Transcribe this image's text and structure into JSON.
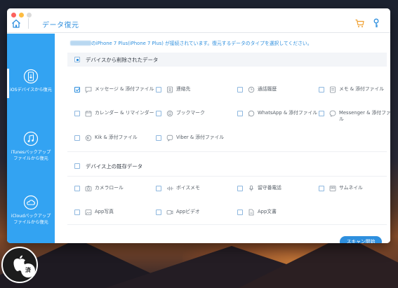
{
  "window": {
    "title": "データ復元"
  },
  "toolbar": {
    "home_icon": "home-icon",
    "cart_icon": "cart-icon",
    "key_icon": "key-icon",
    "accent_color": "#2e8fde",
    "cart_color": "#f0a030"
  },
  "sidebar": {
    "background": "#33a3f2",
    "items": [
      {
        "label": "iOSデバイスから復元",
        "icon": "ios-device-icon",
        "active": true
      },
      {
        "label": "iTunesバックアップファイルから復元",
        "icon": "itunes-music-icon",
        "active": false
      },
      {
        "label": "iCloudバックアップファイルから復元",
        "icon": "icloud-icon",
        "active": false
      }
    ]
  },
  "notice": {
    "text": "のiPhone 7 Plus(iPhone 7 Plus) が接続されています。復元するデータのタイプを選択してください。"
  },
  "sections": [
    {
      "title": "デバイスから削除されたデータ",
      "state": "partial",
      "options": [
        {
          "label": "メッセージ & 添付ファイル",
          "icon": "message-icon",
          "checked": true
        },
        {
          "label": "連絡先",
          "icon": "contacts-icon",
          "checked": false
        },
        {
          "label": "通話履歴",
          "icon": "call-history-icon",
          "checked": false
        },
        {
          "label": "メモ & 添付ファイル",
          "icon": "notes-icon",
          "checked": false
        },
        {
          "label": "カレンダー & リマインダー",
          "icon": "calendar-icon",
          "checked": false
        },
        {
          "label": "ブックマーク",
          "icon": "bookmark-icon",
          "checked": false
        },
        {
          "label": "WhatsApp & 添付ファイル",
          "icon": "whatsapp-icon",
          "checked": false
        },
        {
          "label": "Messenger & 添付ファイル",
          "icon": "messenger-icon",
          "checked": false
        },
        {
          "label": "Kik & 添付ファイル",
          "icon": "kik-icon",
          "checked": false
        },
        {
          "label": "Viber & 添付ファイル",
          "icon": "viber-icon",
          "checked": false
        }
      ]
    },
    {
      "title": "デバイス上の既存データ",
      "state": "unchecked",
      "options": [
        {
          "label": "カメラロール",
          "icon": "camera-icon",
          "checked": false
        },
        {
          "label": "ボイスメモ",
          "icon": "voice-memo-icon",
          "checked": false
        },
        {
          "label": "留守番電話",
          "icon": "voicemail-icon",
          "checked": false
        },
        {
          "label": "サムネイル",
          "icon": "thumbnail-icon",
          "checked": false
        },
        {
          "label": "App写真",
          "icon": "app-photo-icon",
          "checked": false
        },
        {
          "label": "Appビデオ",
          "icon": "app-video-icon",
          "checked": false
        },
        {
          "label": "App文書",
          "icon": "app-document-icon",
          "checked": false
        }
      ]
    }
  ],
  "scan_button": {
    "label": "スキャン開始"
  },
  "badge": {
    "text": "済"
  }
}
